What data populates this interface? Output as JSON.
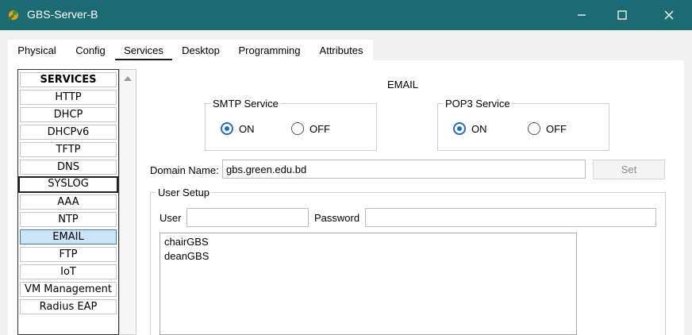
{
  "window": {
    "title": "GBS-Server-B"
  },
  "tabs": [
    "Physical",
    "Config",
    "Services",
    "Desktop",
    "Programming",
    "Attributes"
  ],
  "active_tab": "Services",
  "services": {
    "header": "SERVICES",
    "items": [
      "HTTP",
      "DHCP",
      "DHCPv6",
      "TFTP",
      "DNS",
      "SYSLOG",
      "AAA",
      "NTP",
      "EMAIL",
      "FTP",
      "IoT",
      "VM Management",
      "Radius EAP"
    ],
    "selected": "EMAIL"
  },
  "email": {
    "heading": "EMAIL",
    "smtp": {
      "label": "SMTP Service",
      "on": "ON",
      "off": "OFF",
      "value": "ON"
    },
    "pop3": {
      "label": "POP3 Service",
      "on": "ON",
      "off": "OFF",
      "value": "ON"
    },
    "domain_label": "Domain Name:",
    "domain_value": "gbs.green.edu.bd",
    "set_label": "Set",
    "user_setup": {
      "label": "User Setup",
      "user_label": "User",
      "user_value": "",
      "password_label": "Password",
      "password_value": "",
      "users": [
        "chairGBS",
        "deanGBS"
      ]
    }
  },
  "colors": {
    "titlebar": "#1d6b72",
    "radio_accent": "#1e6fbf",
    "selected_service": "#cde3f7"
  }
}
